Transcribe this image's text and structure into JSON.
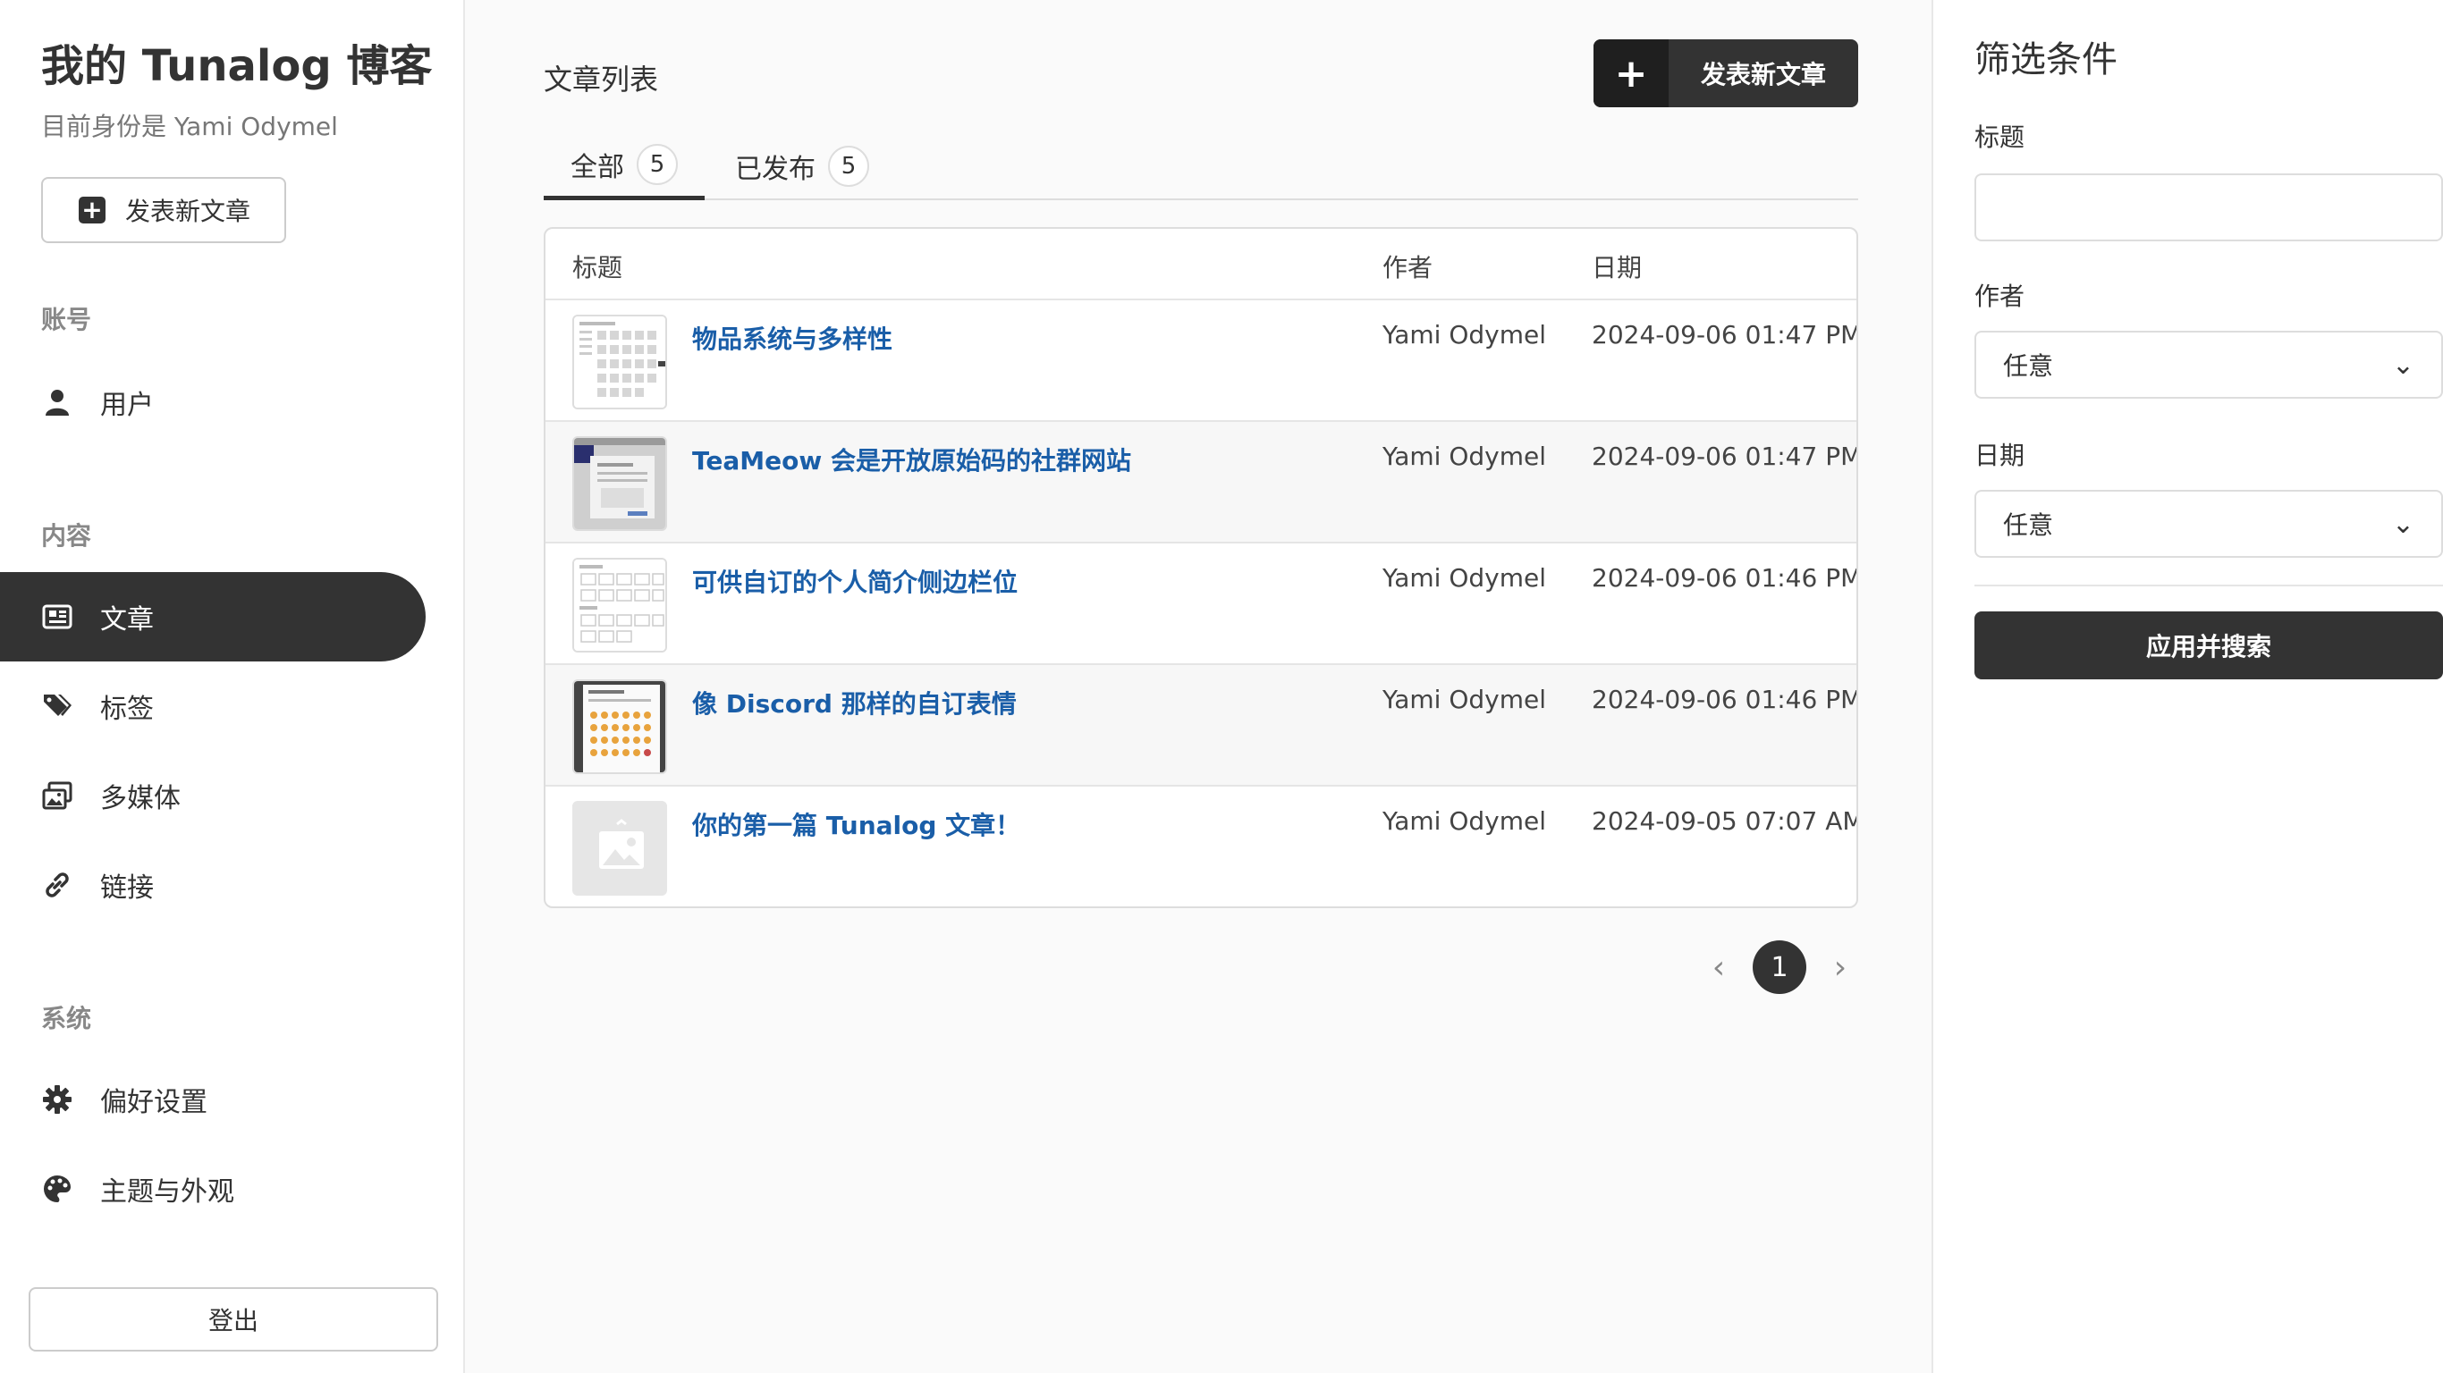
{
  "sidebar": {
    "site_title": "我的 Tunalog 博客",
    "identity": "目前身份是 Yami Odymel",
    "new_post_label": "发表新文章",
    "sections": {
      "account": "账号",
      "content": "内容",
      "system": "系统"
    },
    "items": {
      "users": {
        "label": "用户",
        "icon": "user-icon"
      },
      "posts": {
        "label": "文章",
        "icon": "newspaper-icon"
      },
      "tags": {
        "label": "标签",
        "icon": "tags-icon"
      },
      "media": {
        "label": "多媒体",
        "icon": "images-icon"
      },
      "links": {
        "label": "链接",
        "icon": "link-icon"
      },
      "preferences": {
        "label": "偏好设置",
        "icon": "gear-icon"
      },
      "theme": {
        "label": "主题与外观",
        "icon": "palette-icon"
      }
    },
    "active_item": "posts",
    "logout_label": "登出"
  },
  "main": {
    "title": "文章列表",
    "new_post_label": "发表新文章",
    "tabs": [
      {
        "label": "全部",
        "count": "5",
        "active": true
      },
      {
        "label": "已发布",
        "count": "5",
        "active": false
      }
    ],
    "columns": {
      "title": "标题",
      "author": "作者",
      "date": "日期"
    },
    "rows": [
      {
        "title": "物品系统与多样性",
        "author": "Yami Odymel",
        "date": "2024-09-06 01:47 PM",
        "thumb": "grid-screenshot"
      },
      {
        "title": "TeaMeow 会是开放原始码的社群网站",
        "author": "Yami Odymel",
        "date": "2024-09-06 01:47 PM",
        "thumb": "dark-screenshot"
      },
      {
        "title": "可供自订的个人简介侧边栏位",
        "author": "Yami Odymel",
        "date": "2024-09-06 01:46 PM",
        "thumb": "grid-screenshot"
      },
      {
        "title": "像 Discord 那样的自订表情",
        "author": "Yami Odymel",
        "date": "2024-09-06 01:46 PM",
        "thumb": "emoji-screenshot"
      },
      {
        "title": "你的第一篇 Tunalog 文章！",
        "author": "Yami Odymel",
        "date": "2024-09-05 07:07 AM",
        "thumb": "image-placeholder"
      }
    ],
    "pagination": {
      "current": "1"
    }
  },
  "filter": {
    "title": "筛选条件",
    "title_label": "标题",
    "title_value": "",
    "author_label": "作者",
    "author_value": "任意",
    "date_label": "日期",
    "date_value": "任意",
    "apply_label": "应用并搜索"
  },
  "colors": {
    "dark": "#333333",
    "link": "#1a5ea8",
    "border": "#dddddd"
  }
}
